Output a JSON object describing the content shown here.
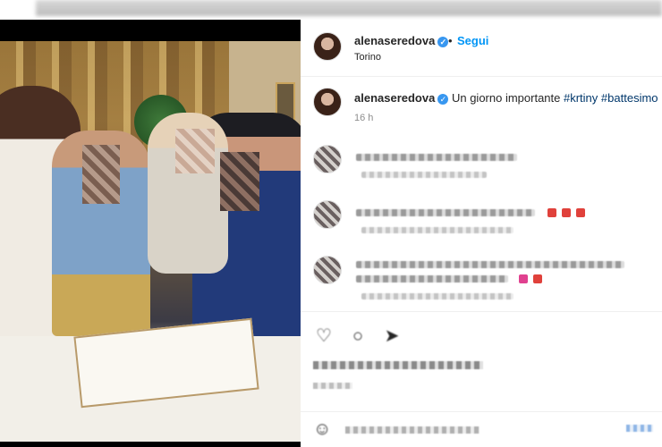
{
  "post": {
    "username": "alenaseredova",
    "verified_glyph": "✓",
    "dot": "•",
    "follow_label": "Segui",
    "location": "Torino"
  },
  "caption": {
    "username": "alenaseredova",
    "text": "Un giorno importante",
    "hashtags": [
      "#krtiny",
      "#battesimo"
    ],
    "time": "16 h"
  },
  "icons": {
    "like": "heart-icon",
    "comment": "comment-icon",
    "share": "share-icon",
    "emoji": "smile-icon"
  },
  "colors": {
    "accent": "#0095f6",
    "verified": "#3897f0",
    "hashtag": "#00376b",
    "emoji_red": "#e0413b",
    "emoji_pink": "#e0418f"
  }
}
